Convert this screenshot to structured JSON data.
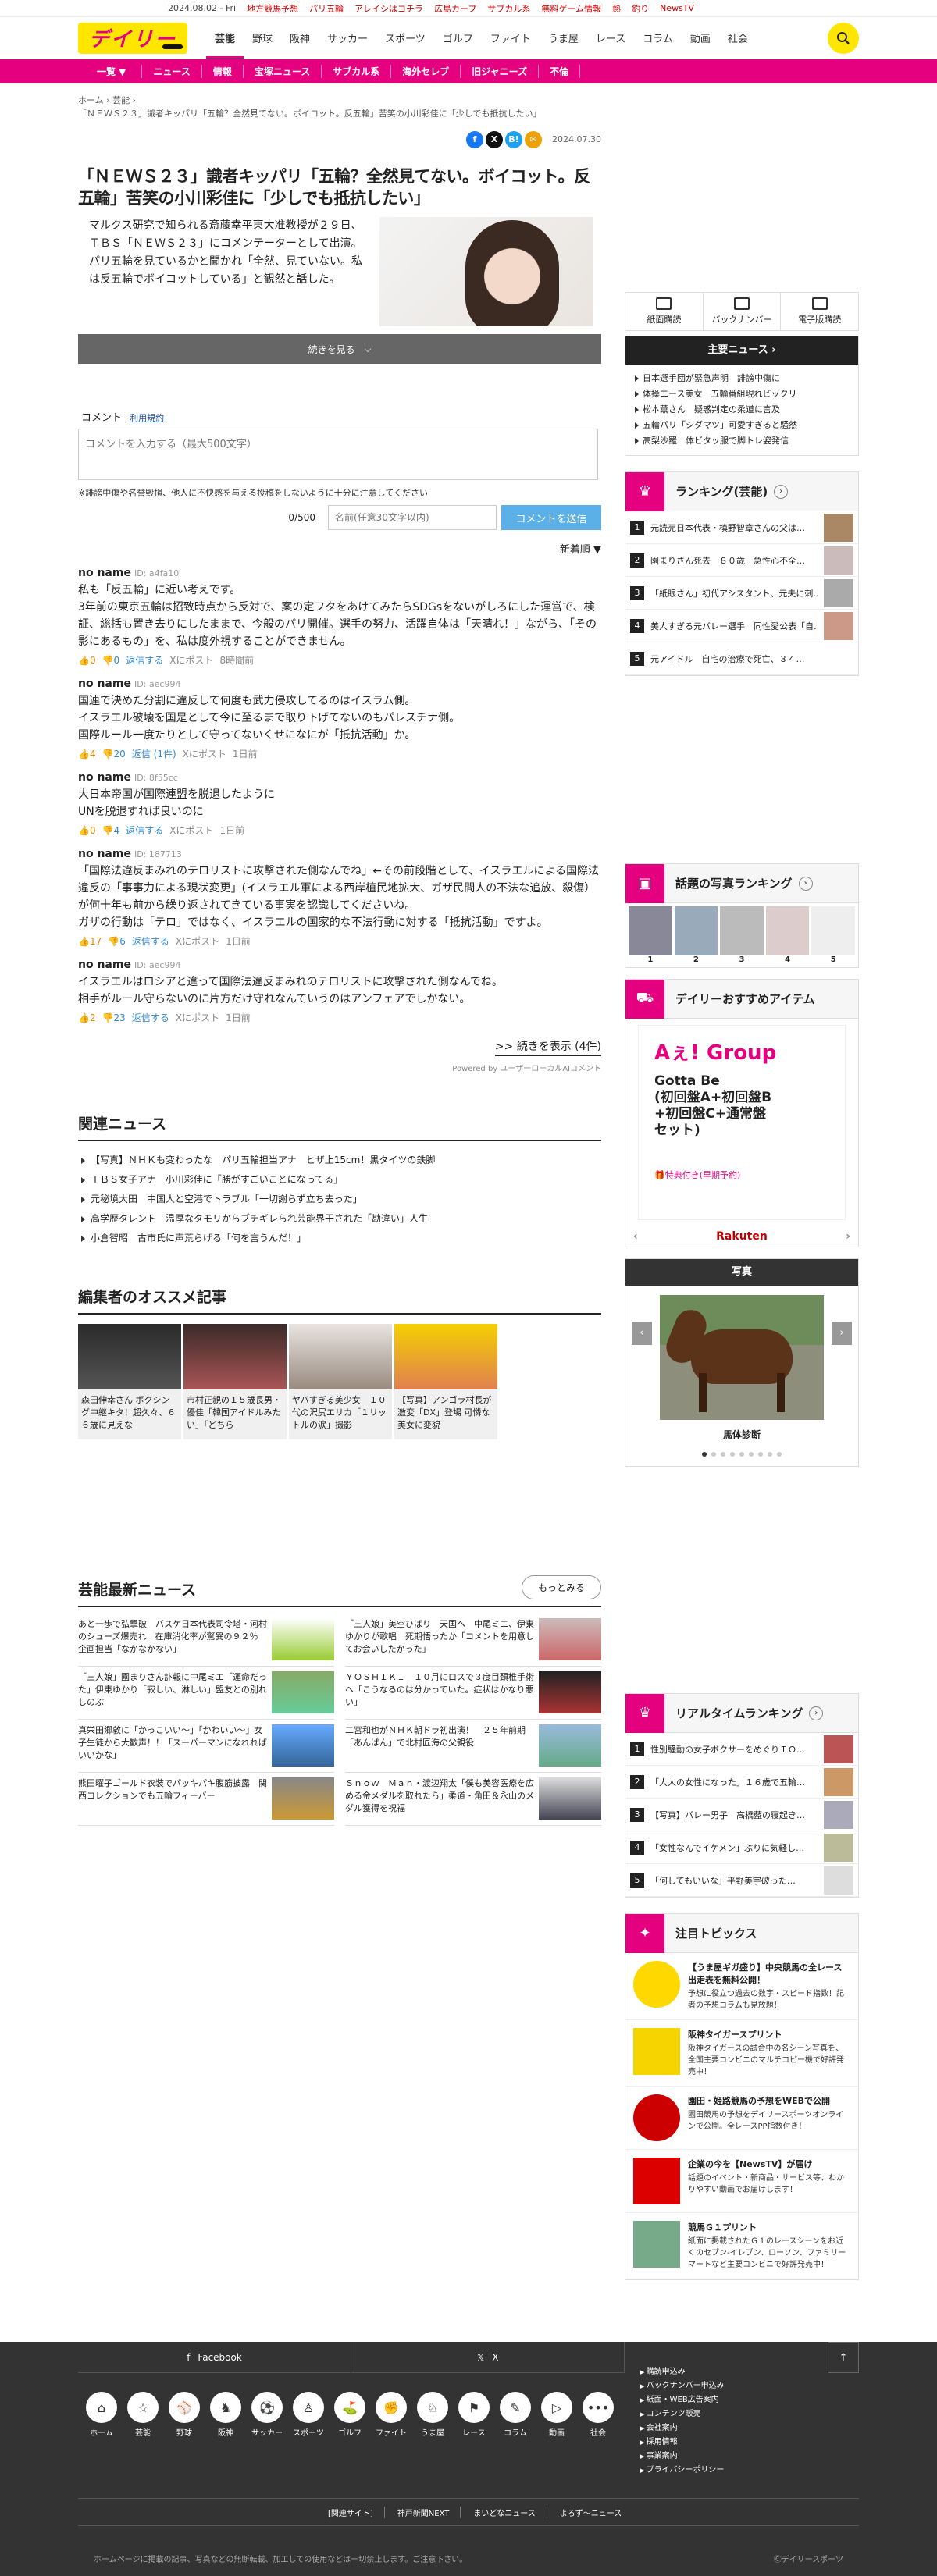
{
  "topbar": {
    "date": "2024.08.02 - Fri",
    "links": [
      "地方競馬予想",
      "パリ五輪",
      "アレイシはコチラ",
      "広島カープ",
      "サブカル系",
      "無料ゲーム情報",
      "熱",
      "釣り",
      "NewsTV"
    ]
  },
  "logo": "デイリー",
  "gnav": [
    "芸能",
    "野球",
    "阪神",
    "サッカー",
    "スポーツ",
    "ゴルフ",
    "ファイト",
    "うま屋",
    "レース",
    "コラム",
    "動画",
    "社会"
  ],
  "pinkbar": [
    "一覧 ▼",
    "ニュース",
    "情報",
    "宝塚ニュース",
    "サブカル系",
    "海外セレブ",
    "旧ジャニーズ",
    "不倫"
  ],
  "breadcrumb": [
    "ホーム",
    "›",
    "芸能",
    "›",
    "「ＮＥＷＳ２３」識者キッパリ「五輪？全然見てない。ボイコット。反五輪」苦笑の小川彩佳に「少しでも抵抗したい」"
  ],
  "article": {
    "pubdate": "2024.07.30",
    "title": "「ＮＥＷＳ２３」識者キッパリ「五輪？全然見てない。ボイコット。反五輪」苦笑の小川彩佳に「少しでも抵抗したい」",
    "lead": "マルクス研究で知られる斎藤幸平東大准教授が２９日、ＴＢＳ「ＮＥＷＳ２３」にコメンテーターとして出演。パリ五輪を見ているかと聞かれ「全然、見ていない。私は反五輪でボイコットしている」と観然と話した。",
    "more_label": "続きを見る"
  },
  "comment_form": {
    "title": "コメント",
    "rules": "利用規約",
    "placeholder": "コメントを入力する（最大500文字）",
    "notice": "※誹謗中傷や名誉毀損、他人に不快感を与える投稿をしないように十分に注意してください",
    "count": "0/500",
    "name_placeholder": "名前(任意30文字以内)",
    "send": "コメントを送信",
    "sort": "新着順 ▼"
  },
  "comments": [
    {
      "name": "no name",
      "id": "ID: a4fa10",
      "text": "私も「反五輪」に近い考えです。\n3年前の東京五輪は招致時点から反対で、案の定フタをあけてみたらSDGsをないがしろにした運営で、検証、総括も置き去りにしたままで、今般のパリ開催。選手の努力、活躍自体は「天晴れ！」ながら、「その影にあるもの」を、私は度外視することができません。",
      "up": "0",
      "down": "0",
      "reply": "返信する",
      "x": "Xにポスト",
      "time": "8時間前"
    },
    {
      "name": "no name",
      "id": "ID: aec994",
      "text": "国連で決めた分割に違反して何度も武力侵攻してるのはイスラム側。\nイスラエル破壊を国是として今に至るまで取り下げてないのもパレスチナ側。\n国際ルール一度たりとして守ってないくせになにが「抵抗活動」か。",
      "up": "4",
      "down": "20",
      "reply": "返信 (1件)",
      "x": "Xにポスト",
      "time": "1日前"
    },
    {
      "name": "no name",
      "id": "ID: 8f55cc",
      "text": "大日本帝国が国際連盟を脱退したように\nUNを脱退すれば良いのに",
      "up": "0",
      "down": "4",
      "reply": "返信する",
      "x": "Xにポスト",
      "time": "1日前"
    },
    {
      "name": "no name",
      "id": "ID: 187713",
      "text": "「国際法違反まみれのテロリストに攻撃された側なんでね」←その前段階として、イスラエルによる国際法違反の「事事力による現状変更」(イスラエル軍による西岸植民地拡大、ガザ民間人の不法な追放、殺傷）が何十年も前から繰り返されてきている事実を認識してくださいね。\nガザの行動は「テロ」ではなく、イスラエルの国家的な不法行動に対する「抵抗活動」ですよ。",
      "up": "17",
      "down": "6",
      "reply": "返信する",
      "x": "Xにポスト",
      "time": "1日前"
    },
    {
      "name": "no name",
      "id": "ID: aec994",
      "text": "イスラエルはロシアと違って国際法違反まみれのテロリストに攻撃された側なんでね。\n相手がルール守らないのに片方だけ守れなんていうのはアンフェアでしかない。",
      "up": "2",
      "down": "23",
      "reply": "返信する",
      "x": "Xにポスト",
      "time": "1日前"
    }
  ],
  "show_more": ">> 続きを表示 (4件)",
  "powered": "Powered by ユーザーローカルAIコメント",
  "related": {
    "title": "関連ニュース",
    "items": [
      "【写真】ＮＨＫも変わったな　パリ五輪担当アナ　ヒザ上15cm！黒タイツの鉄脚",
      "ＴＢＳ女子アナ　小川彩佳に「勝がすごいことになってる」",
      "元秘境大田　中国人と空港でトラブル「一切謝らず立ち去った」",
      "高学歴タレント　温厚なタモリからブチギレられ芸能界干された「勘違い」人生",
      "小倉智昭　古市氏に声荒らげる「何を言うんだ！」"
    ]
  },
  "editors": {
    "title": "編集者のオススメ記事",
    "cards": [
      "森田伸幸さん ボクシング中継キタ！超久々、６６歳に見えな",
      "市村正親の１５歳長男・優佳「韓国アイドルみたい」「どちら",
      "ヤバすぎる美少女　１０代の沢尻エリカ「１リットルの涙」撮影",
      "【写真】アンゴラ村長が激変「DX」登場 可憐な美女に変貌"
    ]
  },
  "latest": {
    "title": "芸能最新ニュース",
    "more": "もっとみる",
    "items": [
      "あと一歩で弘撃破　バスケ日本代表司令塔・河村のシューズ爆売れ　在庫消化率が驚異の９２％　企画担当「なかなかない」",
      "「三人娘」美空ひばり　天国へ　中尾ミエ、伊東ゆかりが歌唱　死期悟ったか「コメントを用意してお会いしたかった」",
      "「三人娘」園まりさん訃報に中尾ミエ「運命だった」伊東ゆかり「寂しい、淋しい」盟友との別れしのぶ",
      "ＹＯＳＨＩＫＩ　１０月にロスで３度目頚椎手術へ「こうなるのは分かっていた。症状はかなり悪い」",
      "真栄田郷敦に「かっこいい～」「かわいい～」女子生徒から大歓声！！「スーパーマンになれればいいかな」",
      "二宮和也がＮＨＫ朝ドラ初出演！　２５年前期「あんぱん」で北村匠海の父親役",
      "熊田曜子ゴールド衣装でパッキパキ腹筋披露　関西コレクションでも五輪フィーバー",
      "Ｓｎｏｗ　Ｍａｎ・渡辺翔太「僕も美容医療を広める金メダルを取れたら」柔道・角田＆永山のメダル獲得を祝福"
    ]
  },
  "side": {
    "top3": [
      "紙面購読",
      "バックナンバー",
      "電子版購読"
    ],
    "headline": {
      "title": "主要ニュース",
      "items": [
        "日本選手団が緊急声明　誹謗中傷に",
        "体操エース美女　五輪番組現れビックリ",
        "松本薫さん　疑惑判定の柔道に言及",
        "五輪パリ「シダマツ」可愛すぎると騒然",
        "高梨沙羅　体ビタッ服で脚トレ姿発信"
      ]
    },
    "ranking": {
      "title": "ランキング(芸能)",
      "items": [
        "元読売日本代表・槙野智章さんの父は…",
        "園まりさん死去　８０歳　急性心不全…",
        "「紙眼さん」初代アシスタント、元夫に刺…",
        "美人すぎる元バレー選手　同性愛公表「自…",
        "元アイドル　自宅の治療で死亡、３４…"
      ]
    },
    "photo_ranking": {
      "title": "話題の写真ランキング",
      "nums": [
        "1",
        "2",
        "3",
        "4",
        "5"
      ]
    },
    "osusume": {
      "title": "デイリーおすすめアイテム",
      "group": "Aぇ! Group",
      "product": "Gotta Be\n(初回盤A+初回盤B\n+初回盤C+通常盤\nセット)",
      "tokuten": "🎁特典付き(早期予約)",
      "rakuten": "Rakuten"
    },
    "photos": {
      "title": "写真",
      "caption": "馬体診断"
    },
    "realtime": {
      "title": "リアルタイムランキング",
      "items": [
        "性別騒動の女子ボクサーをめぐりＩＯ…",
        "「大人の女性になった」１６歳で五輪…",
        "【写真】バレー男子　高橋藍の寝起き…",
        "「女性なんでイケメン」ぶりに気軽し…",
        "「何してもいいな」平野美宇破った…"
      ]
    },
    "topics": {
      "title": "注目トピックス",
      "items": [
        {
          "b": "【うま屋ギガ盛り】中央競馬の全レース出走表を無料公開！",
          "d": "予想に役立つ過去の数字・スピード指数！記者の予想コラムも見放題！"
        },
        {
          "b": "阪神タイガースプリント",
          "d": "阪神タイガースの試合中の名シーン写真を、全国主要コンビニのマルチコピー機で好評発売中！"
        },
        {
          "b": "園田・姫路競馬の予想をWEBで公開",
          "d": "園田競馬の予想をデイリースポーツオンラインで公開。全レースPP指数付き！"
        },
        {
          "b": "企業の今を【NewsTV】が届け",
          "d": "話題のイベント・新商品・サービス等、わかりやすい動画でお届けします！"
        },
        {
          "b": "競馬Ｇ１プリント",
          "d": "紙面に掲載されたＧ１のレースシーンをお近くのセブン-イレブン、ローソン、ファミリーマートなど主要コンビニで好評発売中！"
        }
      ]
    }
  },
  "footer": {
    "facebook": "Facebook",
    "x": "X",
    "cats": [
      "ホーム",
      "芸能",
      "野球",
      "阪神",
      "サッカー",
      "スポーツ",
      "ゴルフ",
      "ファイト",
      "うま屋",
      "レース",
      "コラム",
      "動画",
      "社会"
    ],
    "links": [
      "購読申込み",
      "バックナンバー申込み",
      "紙面・WEB広告案内",
      "コンテンツ販売",
      "会社案内",
      "採用情報",
      "事業案内",
      "プライバシーポリシー"
    ],
    "group": [
      "[関連サイト]",
      "神戸新聞NEXT",
      "まいどなニュース",
      "よろず～ニュース"
    ],
    "copyright": "ホームページに掲載の記事、写真などの無断転載、加工しての使用などは一切禁止します。ご注意下さい。",
    "copyright2": "Ⓒデイリースポーツ"
  }
}
